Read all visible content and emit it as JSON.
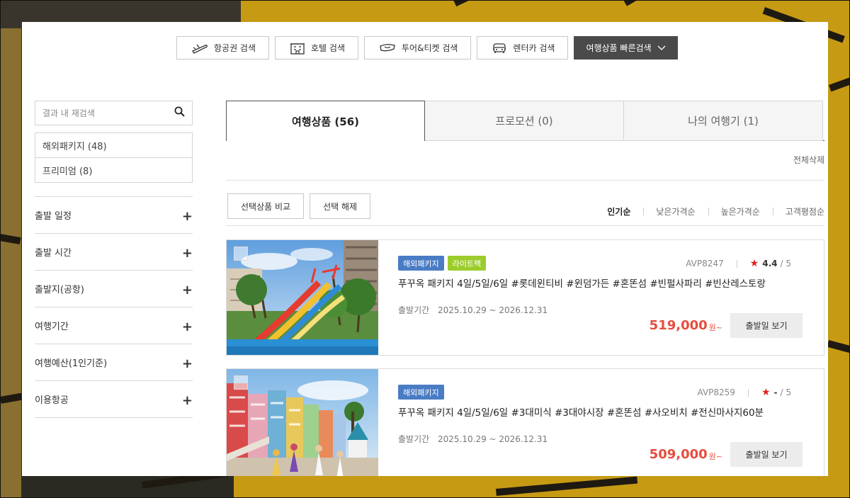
{
  "colors": {
    "accent_price": "#e74c3c",
    "badge_package": "#4a7cc4",
    "badge_lite": "#9ccc2c",
    "dark_button": "#4a4a4a",
    "star": "#e02020"
  },
  "topnav": {
    "items": [
      {
        "label": "항공권 검색",
        "icon": "airplane-icon"
      },
      {
        "label": "호텔 검색",
        "icon": "hotel-icon"
      },
      {
        "label": "투어&티켓 검색",
        "icon": "ticket-icon"
      },
      {
        "label": "렌터카 검색",
        "icon": "car-icon"
      }
    ],
    "quick_search": "여행상품 빠른검색"
  },
  "sidebar": {
    "search_placeholder": "결과 내 재검색",
    "categories": [
      "해외패키지 (48)",
      "프리미엄 (8)"
    ],
    "filters": [
      "출발 일정",
      "출발 시간",
      "출발지(공항)",
      "여행기간",
      "여행예산(1인기준)",
      "이용항공"
    ],
    "expand_symbol": "+"
  },
  "tabs": [
    "여행상품 (56)",
    "프로모션 (0)",
    "나의 여행기 (1)"
  ],
  "delete_all": "전체삭제",
  "actions": {
    "compare": "선택상품 비교",
    "deselect": "선택 해제"
  },
  "sorts": [
    "인기순",
    "낮은가격순",
    "높은가격순",
    "고객평점순"
  ],
  "products": [
    {
      "badges": [
        "해외패키지",
        "라이트팩"
      ],
      "code": "AVP8247",
      "rating": "4.4",
      "rating_max": "/ 5",
      "title": "푸꾸옥 패키지 4일/5일/6일 #롯데윈티비 #윈덤가든 #혼똔섬 #빈펄사파리 #빈산레스토랑",
      "period_label": "출발기간",
      "period": "2025.10.29 ~ 2026.12.31",
      "price": "519,000",
      "won": "원~",
      "button": "출발일 보기"
    },
    {
      "badges": [
        "해외패키지"
      ],
      "code": "AVP8259",
      "rating": "-",
      "rating_max": "/ 5",
      "title": "푸꾸옥 패키지 4일/5일/6일 #3대미식 #3대야시장 #혼똔섬 #사오비치 #전신마사지60분",
      "period_label": "출발기간",
      "period": "2025.10.29 ~ 2026.12.31",
      "price": "509,000",
      "won": "원~",
      "button": "출발일 보기"
    }
  ]
}
